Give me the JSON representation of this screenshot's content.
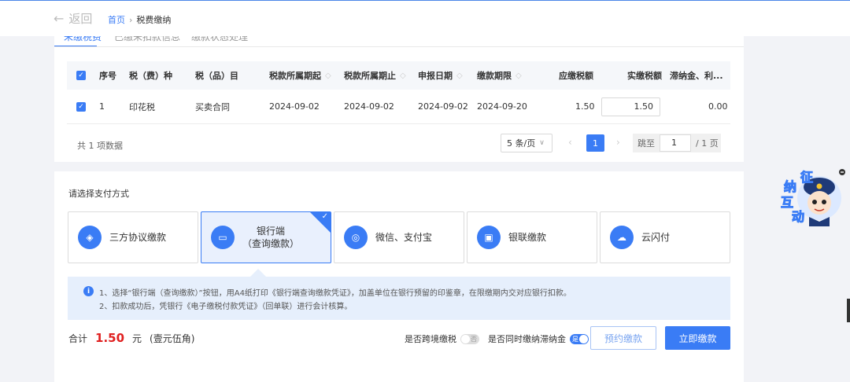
{
  "header": {
    "back_label": "返回",
    "breadcrumb_home": "首页",
    "breadcrumb_sep": "›",
    "breadcrumb_current": "税费缴纳"
  },
  "tabs": [
    {
      "label": "未缴税费",
      "active": true
    },
    {
      "label": "已缴未扣款信息",
      "active": false
    },
    {
      "label": "缴款状态处理",
      "active": false
    }
  ],
  "table": {
    "columns": [
      "序号",
      "税（费）种",
      "税（品）目",
      "税款所属期起",
      "税款所属期止",
      "申报日期",
      "缴款期限",
      "应缴税额",
      "实缴税额",
      "滞纳金、利..."
    ],
    "rows": [
      {
        "index": "1",
        "tax_type": "印花税",
        "tax_item": "买卖合同",
        "period_start": "2024-09-02",
        "period_end": "2024-09-02",
        "declare_date": "2024-09-02",
        "deadline": "2024-09-20",
        "due_amount": "1.50",
        "paid_amount": "1.50",
        "late_fee": "0.00"
      }
    ]
  },
  "pagination": {
    "total_text": "共 1 项数据",
    "page_size": "5 条/页",
    "current_page": "1",
    "jump_label": "跳至",
    "jump_value": "1",
    "total_pages": "/ 1 页"
  },
  "payment": {
    "title": "请选择支付方式",
    "methods": [
      {
        "label": "三方协议缴款",
        "icon": "agreement-icon"
      },
      {
        "label": "银行端\n（查询缴款）",
        "icon": "bank-card-icon",
        "selected": true
      },
      {
        "label": "微信、支付宝",
        "icon": "wechat-alipay-icon"
      },
      {
        "label": "银联缴款",
        "icon": "unionpay-icon"
      },
      {
        "label": "云闪付",
        "icon": "cloud-pay-icon"
      }
    ],
    "notice_1": "1、选择“银行端（查询缴款）”按钮，用A4纸打印《银行端查询缴款凭证》，加盖单位在银行预留的印鉴章，在限缴期内交对应银行扣款。",
    "notice_2": "2、扣款成功后，凭银行《电子缴税付款凭证》（回单联）进行会计核算。"
  },
  "footer": {
    "total_label": "合计",
    "total_amount": "1.50",
    "unit": "元",
    "amount_words": "(壹元伍角)",
    "cross_region_label": "是否跨境缴税",
    "cross_region_toggle": "否",
    "late_fee_label": "是否同时缴纳滞纳金",
    "late_fee_toggle": "是",
    "reserve_button": "预约缴款",
    "pay_button": "立即缴款"
  },
  "mascot": {
    "text": "征纳互动"
  },
  "colors": {
    "primary": "#3a7cf5",
    "amount_red": "#e02020"
  }
}
